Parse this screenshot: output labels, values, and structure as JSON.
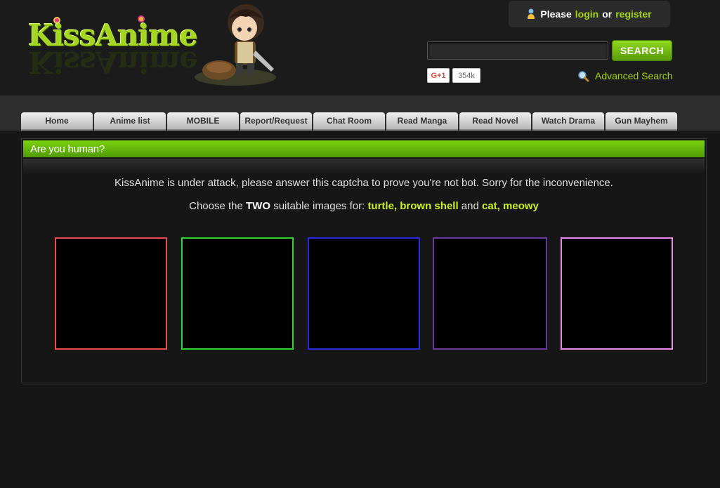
{
  "header": {
    "logo_text": "KissAnime",
    "login": {
      "please": "Please",
      "login": "login",
      "or": "or",
      "register": "register"
    },
    "search": {
      "placeholder": "",
      "button": "SEARCH"
    },
    "gplus": {
      "label": "G+1",
      "count": "354k"
    },
    "advanced_search": "Advanced Search"
  },
  "menu": [
    "Home",
    "Anime list",
    "MOBILE",
    "Report/Request",
    "Chat Room",
    "Read Manga",
    "Read Novel",
    "Watch Drama",
    "Gun Mayhem"
  ],
  "panel": {
    "title": "Are you human?",
    "message": "KissAnime is under attack, please answer this captcha to prove you're not bot. Sorry for the inconvenience.",
    "instruction": {
      "prefix": "Choose the",
      "count": "TWO",
      "middle": "suitable images for:",
      "kw1": "turtle, brown shell",
      "and": "and",
      "kw2": "cat, meowy"
    },
    "captcha_border_colors": [
      "#e84a4a",
      "#33d033",
      "#2a2ad8",
      "#6a3a9a",
      "#e88ae8"
    ]
  }
}
